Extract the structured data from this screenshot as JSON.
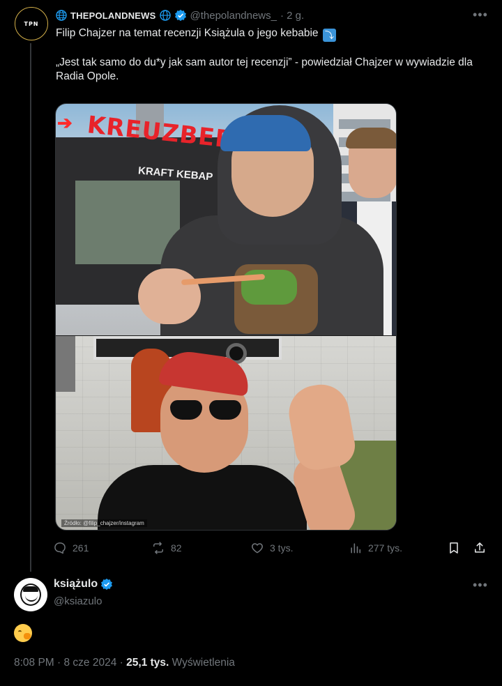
{
  "tweet": {
    "author_name": "THEPOLANDNEWS",
    "author_handle": "@thepolandnews_",
    "time": "· 2 g.",
    "avatar_text": "TPN",
    "line1": "Filip Chajzer na temat recenzji Książula o jego kebabie",
    "arrow_emoji": "⤵",
    "line2": "„Jest tak samo do du*y jak sam autor tej recenzji” - powiedział Chajzer w wywiadzie dla Radia Opole.",
    "more_icon": "more-horizontal-icon",
    "image": {
      "sign_text": "KREUZBERG",
      "kiosk_text": "KRAFT KEBAP",
      "watermark": "Źródło: @filip_chajzer/instagram"
    },
    "actions": {
      "replies": "261",
      "reposts": "82",
      "likes": "3 tys.",
      "views": "277 tys."
    }
  },
  "reply": {
    "author_name": "książulo",
    "author_handle": "@ksiazulo",
    "emoji": "🤭",
    "time": "8:08 PM · 8 cze 2024 ·",
    "views_count": "25,1 tys.",
    "views_label": "Wyświetlenia"
  },
  "colors": {
    "background": "#000000",
    "text": "#e7e9ea",
    "secondary": "#71767b",
    "verified": "#1d9bf0",
    "divider": "#333639"
  }
}
